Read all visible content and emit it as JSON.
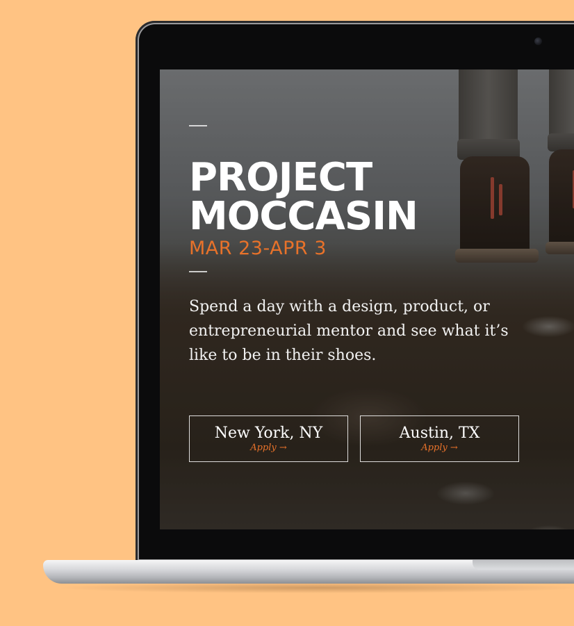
{
  "hero": {
    "title": "PROJECT\nMOCCASIN",
    "dates": "MAR 23-APR 3",
    "description": "Spend a day with a design, product, or entrepreneurial mentor and see what it’s like to be in their shoes."
  },
  "locations": [
    {
      "city": "New York, NY",
      "action": "Apply →"
    },
    {
      "city": "Austin, TX",
      "action": "Apply →"
    }
  ],
  "colors": {
    "background": "#ffc383",
    "accent": "#e8722a",
    "text": "#ffffff",
    "bezel": "#0b0b0c"
  },
  "icons": {
    "camera": "webcam-dot",
    "arrow": "right-arrow"
  }
}
